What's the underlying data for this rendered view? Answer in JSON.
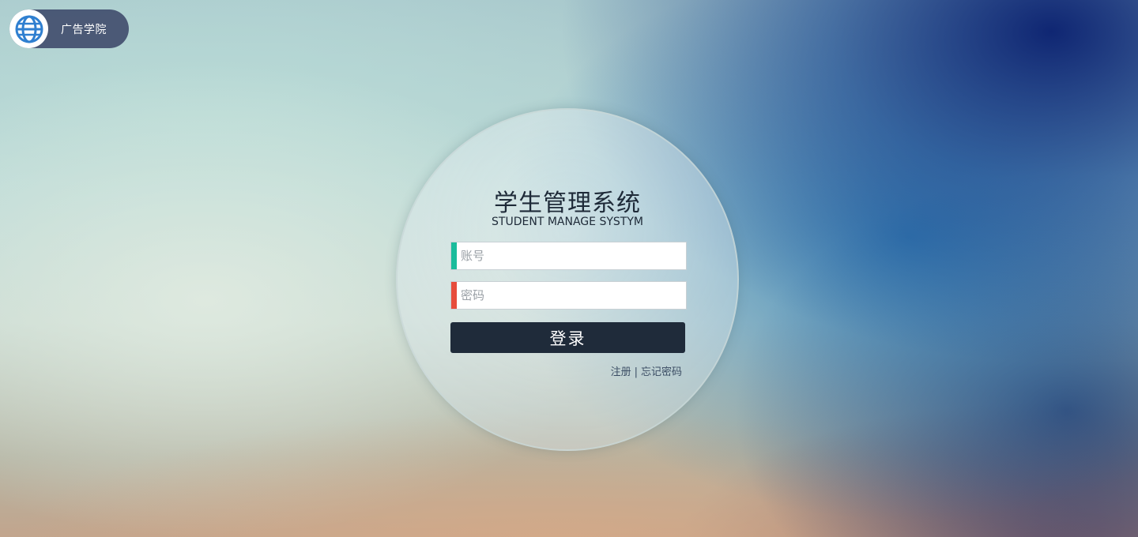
{
  "brand": {
    "name": "广告学院",
    "logo_icon": "globe-icon",
    "logo_color": "#2f7fd0"
  },
  "login": {
    "title": "学生管理系统",
    "subtitle": "STUDENT MANAGE SYSTYM",
    "username": {
      "placeholder": "账号",
      "value": "",
      "accent_color": "#1abc9c"
    },
    "password": {
      "placeholder": "密码",
      "value": "",
      "accent_color": "#e74c3c"
    },
    "submit_label": "登录",
    "register_link": "注册",
    "separator": "|",
    "forgot_link": "忘记密码"
  }
}
